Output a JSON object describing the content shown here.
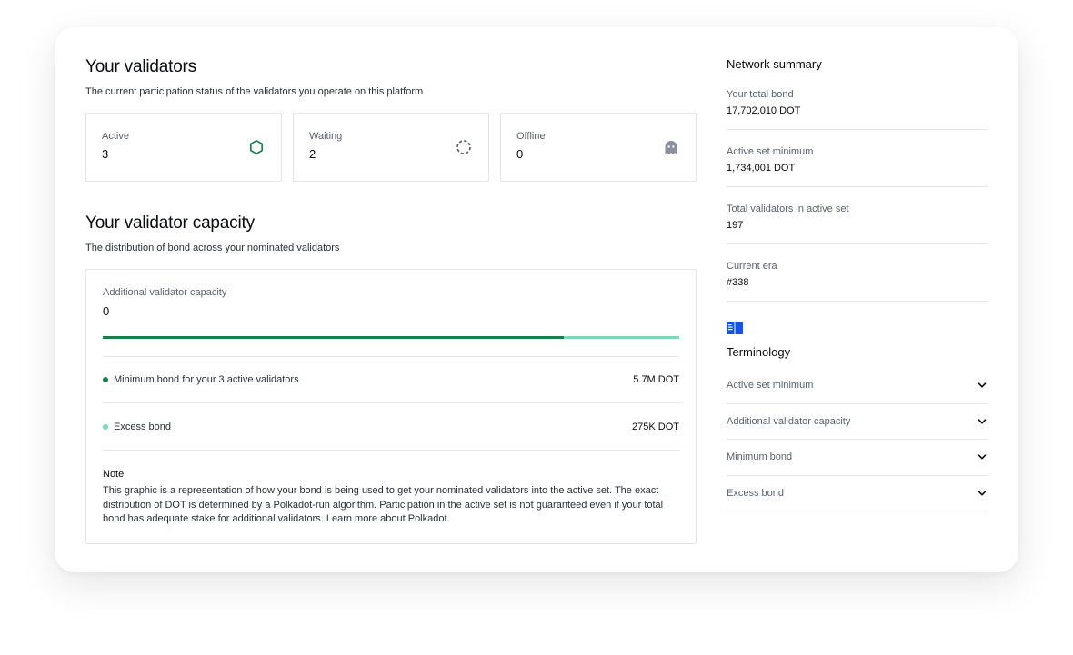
{
  "validators": {
    "title": "Your validators",
    "subtitle": "The current participation status of the validators you operate on this platform",
    "statuses": [
      {
        "label": "Active",
        "value": "3",
        "icon": "hexagon-icon",
        "color": "#1a7f4a"
      },
      {
        "label": "Waiting",
        "value": "2",
        "icon": "dashed-circle-icon",
        "color": "#5b616e"
      },
      {
        "label": "Offline",
        "value": "0",
        "icon": "ghost-icon",
        "color": "#8a919e"
      }
    ]
  },
  "capacity": {
    "title": "Your validator capacity",
    "subtitle": "The distribution of bond across your nominated validators",
    "label": "Additional validator capacity",
    "value": "0",
    "bar_fill_fraction": 0.8,
    "colors": {
      "minimum": "#1a7f4a",
      "excess": "#7dd8b5"
    },
    "rows": [
      {
        "label": "Minimum bond for your 3 active validators",
        "value": "5.7M DOT"
      },
      {
        "label": "Excess bond",
        "value": "275K DOT"
      }
    ],
    "note": {
      "title": "Note",
      "text": "This graphic is a representation of how your bond is being used to get your nominated validators into the active set. The exact distribution of DOT is determined by a Polkadot-run algorithm. Participation in the active set is not guaranteed even if your total bond has adequate stake for additional validators. Learn more about Polkadot."
    }
  },
  "network_summary": {
    "title": "Network summary",
    "items": [
      {
        "label": "Your total bond",
        "value": "17,702,010 DOT"
      },
      {
        "label": "Active set minimum",
        "value": "1,734,001 DOT"
      },
      {
        "label": "Total validators in active set",
        "value": "197"
      },
      {
        "label": "Current era",
        "value": "#338"
      }
    ]
  },
  "terminology": {
    "icon": "book-icon",
    "title": "Terminology",
    "items": [
      {
        "label": "Active set minimum"
      },
      {
        "label": "Additional validator capacity"
      },
      {
        "label": "Minimum bond"
      },
      {
        "label": "Excess bond"
      }
    ]
  }
}
